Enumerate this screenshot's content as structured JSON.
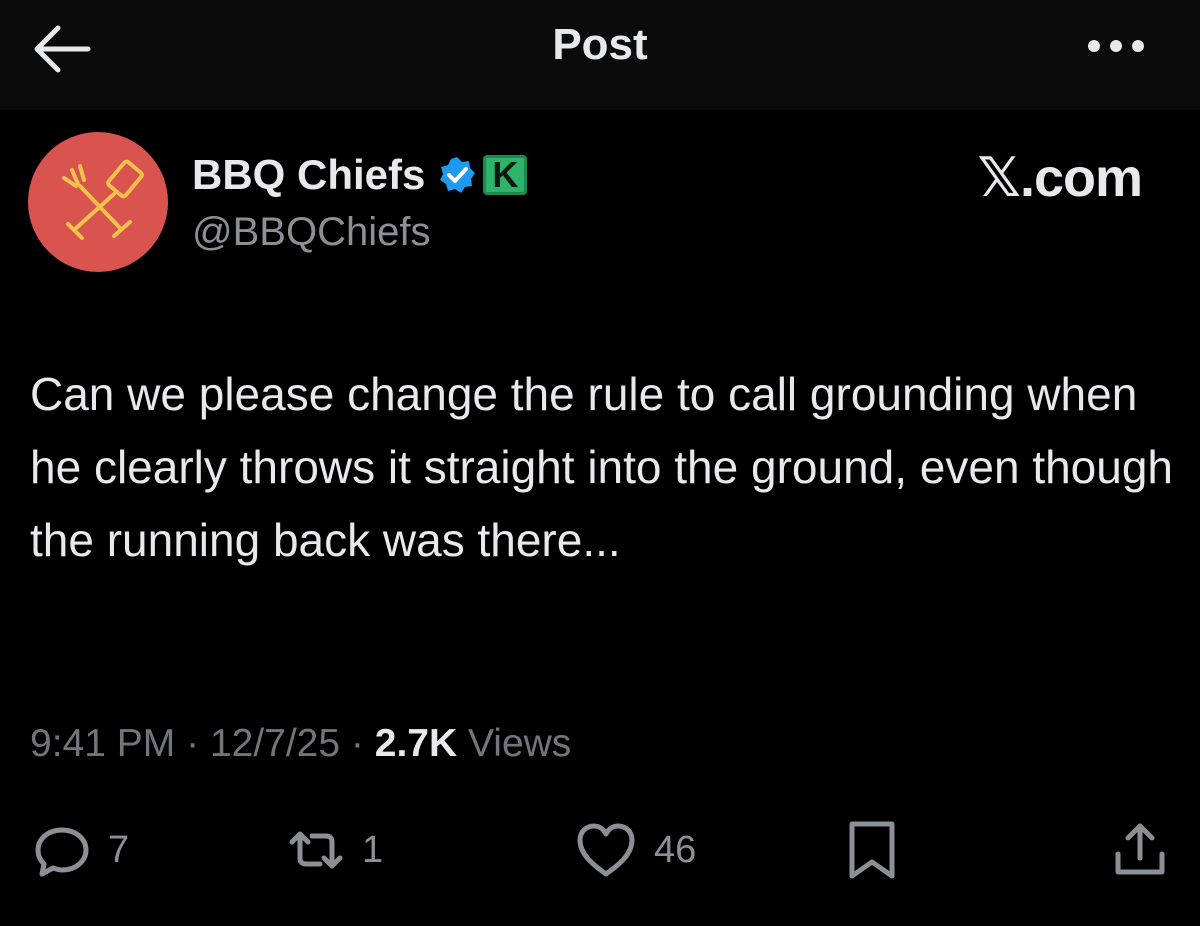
{
  "header": {
    "title": "Post",
    "back_icon": "arrow-left-icon",
    "more_icon": "more-horizontal-icon"
  },
  "author": {
    "display_name": "BBQ Chiefs",
    "handle": "@BBQChiefs",
    "avatar_icon": "crossed-grill-tools-icon",
    "avatar_color": "#d9534f",
    "verified_color": "#1d9bf0",
    "badge_letter": "K",
    "badge_color": "#2fb36a"
  },
  "site_label": "𝕏.com",
  "post": {
    "text": "Can we please change the rule to call grounding when he clearly throws it straight into the ground, even though the running back was there..."
  },
  "meta": {
    "time": "9:41 PM",
    "date": "12/7/25",
    "separator": "·",
    "views_count": "2.7K",
    "views_label": "Views"
  },
  "actions": {
    "reply_count": "7",
    "repost_count": "1",
    "like_count": "46"
  }
}
